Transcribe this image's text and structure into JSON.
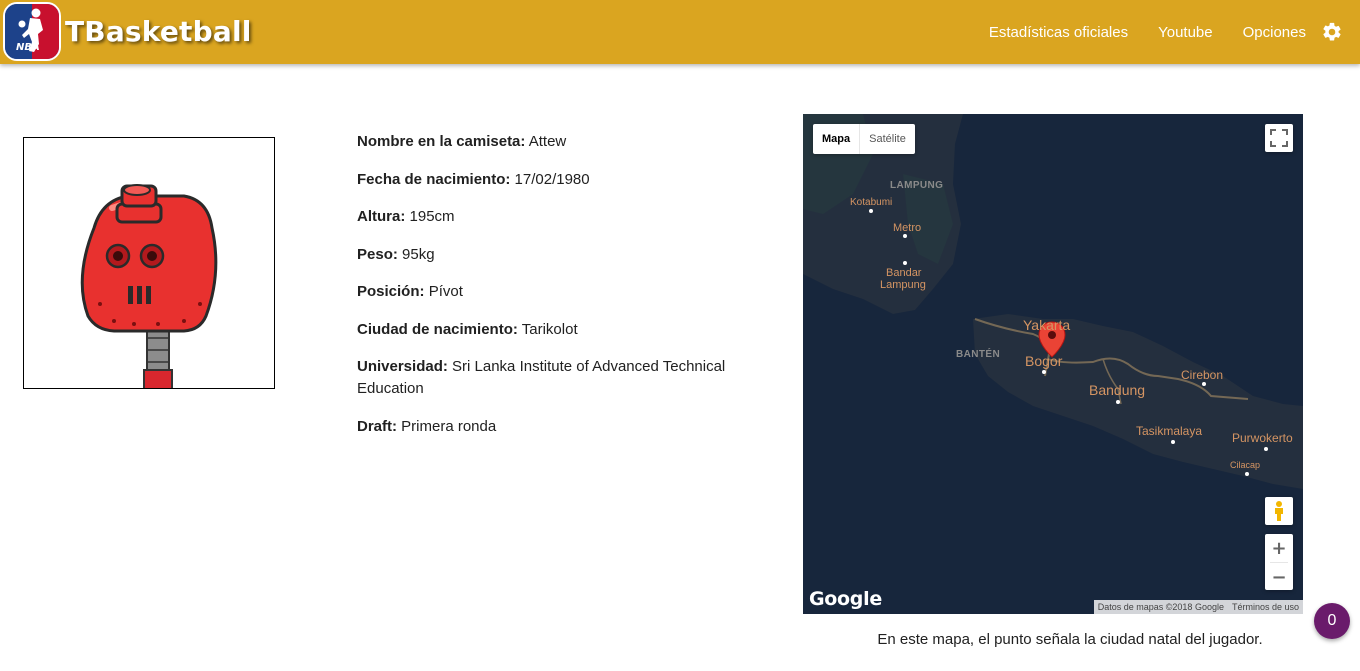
{
  "header": {
    "logo_text": "NBA",
    "app_name": "TBasketball",
    "nav": [
      "Estadísticas oficiales",
      "Youtube",
      "Opciones"
    ],
    "settings_icon": "gear-icon"
  },
  "player": {
    "avatar_icon": "robot-avatar",
    "fields": [
      {
        "label": "Nombre en la camiseta:",
        "value": "Attew"
      },
      {
        "label": "Fecha de nacimiento:",
        "value": "17/02/1980"
      },
      {
        "label": "Altura:",
        "value": "195cm"
      },
      {
        "label": "Peso:",
        "value": "95kg"
      },
      {
        "label": "Posición:",
        "value": "Pívot"
      },
      {
        "label": "Ciudad de nacimiento:",
        "value": "Tarikolot"
      },
      {
        "label": "Universidad:",
        "value": "Sri Lanka Institute of Advanced Technical Education"
      },
      {
        "label": "Draft:",
        "value": "Primera ronda"
      }
    ]
  },
  "map": {
    "type_buttons": [
      "Mapa",
      "Satélite"
    ],
    "selected_type": "Mapa",
    "labels": {
      "lampung": "LAMPUNG",
      "kotabumi": "Kotabumi",
      "metro": "Metro",
      "bandar1": "Bandar",
      "bandar2": "Lampung",
      "banten": "BANTÉN",
      "yakarta": "Yakarta",
      "bogor": "Bogor",
      "bandung": "Bandung",
      "cirebon": "Cirebon",
      "tasikmalaya": "Tasikmalaya",
      "purwokerto": "Purwokerto",
      "cilacap": "Cilacap"
    },
    "zoom_in": "+",
    "zoom_out": "−",
    "google": "Google",
    "attribution": "Datos de mapas ©2018 Google",
    "terms": "Términos de uso",
    "colors": {
      "water": "#17263c",
      "land": "#242f3e",
      "label": "#d59563",
      "marker": "#ea4335"
    }
  },
  "caption": "En este mapa, el punto señala la ciudad natal del jugador.",
  "notification_count": "0",
  "colors": {
    "header": "#daa520",
    "badge": "#6a1b6b"
  }
}
